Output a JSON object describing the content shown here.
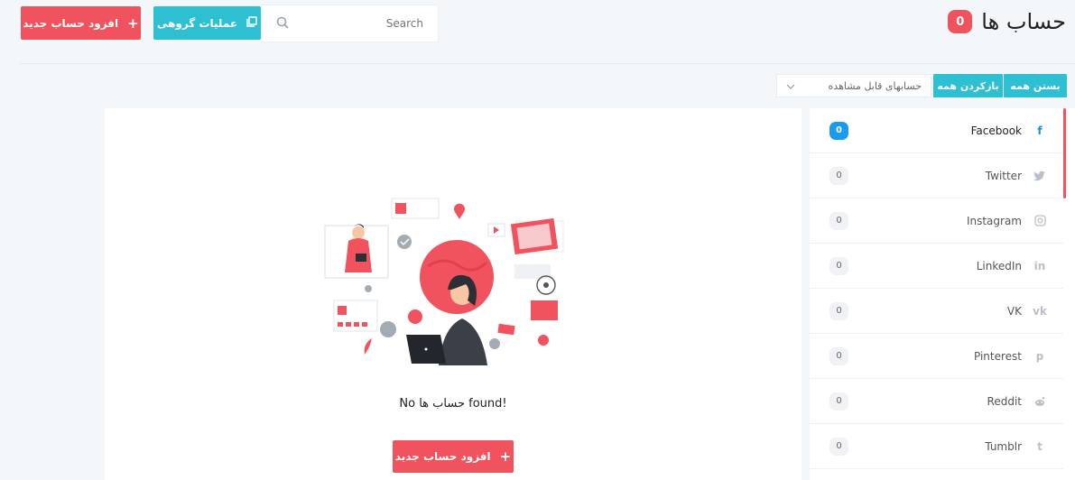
{
  "header": {
    "title": "حساب ها",
    "count": "0",
    "add_button": "افزود حساب جدید",
    "bulk_button": "عملیات گروهی",
    "search_placeholder": "Search"
  },
  "toolbar": {
    "close_all": "بستن همه",
    "open_all": "بازکردن همه",
    "visible_select": "حسابهای قابل مشاهده"
  },
  "empty_state": {
    "message": "No حساب ها found!",
    "add_button": "افزود حساب جدید"
  },
  "sidebar": {
    "items": [
      {
        "label": "Facebook",
        "count": "0",
        "icon": "facebook-icon"
      },
      {
        "label": "Twitter",
        "count": "0",
        "icon": "twitter-icon"
      },
      {
        "label": "Instagram",
        "count": "0",
        "icon": "instagram-icon"
      },
      {
        "label": "LinkedIn",
        "count": "0",
        "icon": "linkedin-icon"
      },
      {
        "label": "VK",
        "count": "0",
        "icon": "vk-icon"
      },
      {
        "label": "Pinterest",
        "count": "0",
        "icon": "pinterest-icon"
      },
      {
        "label": "Reddit",
        "count": "0",
        "icon": "reddit-icon"
      },
      {
        "label": "Tumblr",
        "count": "0",
        "icon": "tumblr-icon"
      }
    ]
  },
  "colors": {
    "accent_red": "#f1535e",
    "accent_teal": "#2ebfd3",
    "facebook_blue": "#1a9bf2"
  }
}
